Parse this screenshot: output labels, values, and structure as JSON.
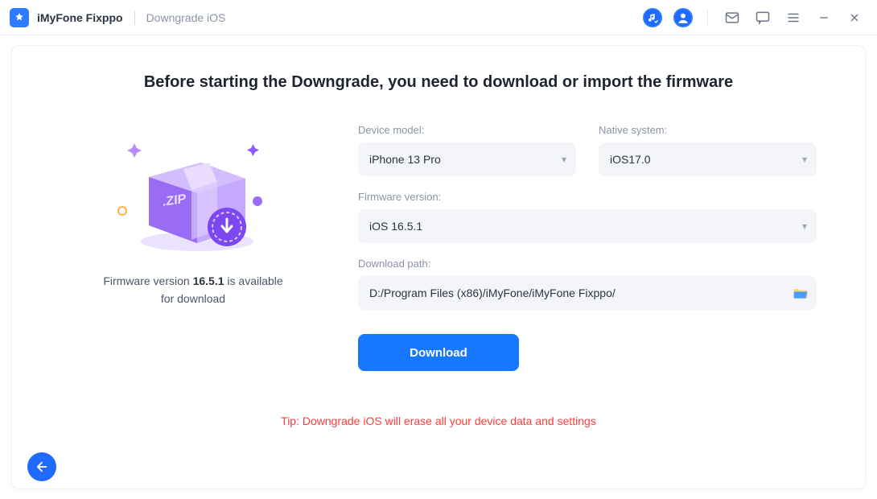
{
  "titlebar": {
    "app_name": "iMyFone Fixppo",
    "breadcrumb": "Downgrade iOS"
  },
  "heading": "Before starting the Downgrade, you need to download or import the firmware",
  "illustration": {
    "badge_text": ".ZIP",
    "caption_prefix": "Firmware version ",
    "caption_version": "16.5.1",
    "caption_suffix_line1": " is available",
    "caption_line2": "for download"
  },
  "form": {
    "device_model_label": "Device model:",
    "device_model_value": "iPhone 13 Pro",
    "native_system_label": "Native system:",
    "native_system_value": "iOS17.0",
    "firmware_version_label": "Firmware version:",
    "firmware_version_value": "iOS 16.5.1",
    "download_path_label": "Download path:",
    "download_path_value": "D:/Program Files (x86)/iMyFone/iMyFone Fixppo/"
  },
  "download_button": "Download",
  "tip": "Tip: Downgrade iOS will erase all your device data and settings"
}
